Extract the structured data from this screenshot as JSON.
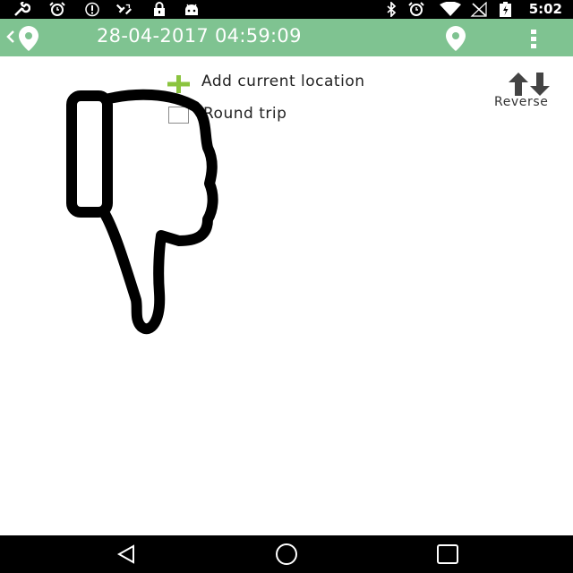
{
  "status_bar": {
    "time": "5:02",
    "icons": [
      "wrench-icon",
      "alarm-icon",
      "info-icon",
      "satellite-icon",
      "lock-icon",
      "android-icon",
      "bluetooth-icon",
      "alarm-icon",
      "wifi-icon",
      "no-signal-icon",
      "battery-charging-icon"
    ]
  },
  "app_bar": {
    "title": "28-04-2017 04:59:09",
    "color": "#7fc391"
  },
  "content": {
    "add_location_label": "Add current location",
    "round_trip_label": "Round trip",
    "round_trip_checked": false,
    "reverse_label": "Reverse"
  },
  "overlay": {
    "icon": "thumbs-down-icon"
  },
  "nav_bar": {
    "buttons": [
      "back-triangle-icon",
      "home-circle-icon",
      "recents-square-icon"
    ]
  }
}
